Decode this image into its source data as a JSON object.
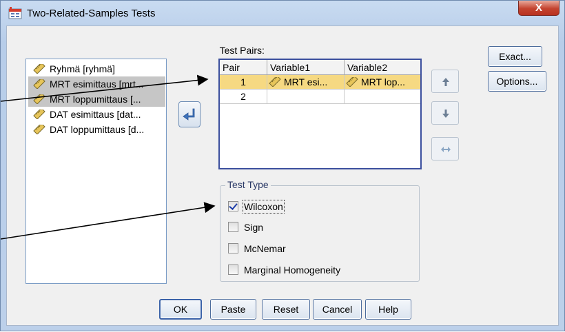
{
  "window": {
    "title": "Two-Related-Samples Tests",
    "close_label": "X"
  },
  "variables": [
    {
      "label": "Ryhmä [ryhmä]",
      "selected": false
    },
    {
      "label": "MRT esimittaus [mrt...",
      "selected": true
    },
    {
      "label": "MRT loppumittaus [...",
      "selected": true
    },
    {
      "label": "DAT esimittaus [dat...",
      "selected": false
    },
    {
      "label": "DAT loppumittaus [d...",
      "selected": false
    }
  ],
  "test_pairs": {
    "label": "Test Pairs:",
    "columns": [
      "Pair",
      "Variable1",
      "Variable2"
    ],
    "rows": [
      {
        "pair": "1",
        "variable1": "MRT esi...",
        "variable2": "MRT lop..."
      },
      {
        "pair": "2",
        "variable1": "",
        "variable2": ""
      }
    ]
  },
  "test_type": {
    "title": "Test Type",
    "options": [
      {
        "label": "Wilcoxon",
        "checked": true
      },
      {
        "label": "Sign",
        "checked": false
      },
      {
        "label": "McNemar",
        "checked": false
      },
      {
        "label": "Marginal Homogeneity",
        "checked": false
      }
    ]
  },
  "side_buttons": {
    "exact": "Exact...",
    "options": "Options..."
  },
  "bottom_buttons": {
    "ok": "OK",
    "paste": "Paste",
    "reset": "Reset",
    "cancel": "Cancel",
    "help": "Help"
  },
  "colors": {
    "selected_row": "#f6d982",
    "table_border": "#3b4f9d",
    "title_bar": "#c9dbf1",
    "close_red": "#c4432f"
  },
  "icons": [
    "spss-dialog-icon",
    "ruler-scale-icon",
    "move-arrow-icon",
    "up-arrow-icon",
    "down-arrow-icon",
    "swap-arrow-icon",
    "checkmark-icon"
  ]
}
